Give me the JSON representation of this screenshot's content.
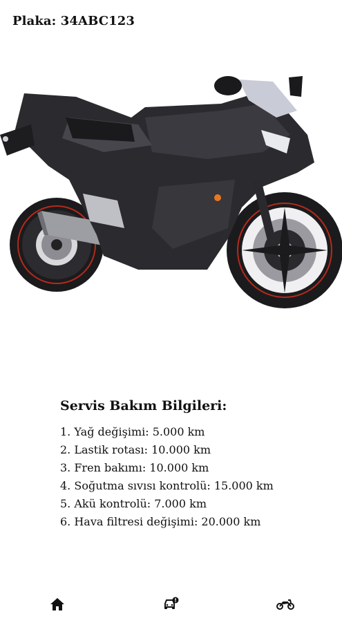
{
  "header": {
    "plate_text": "Plaka: 34ABC123"
  },
  "vehicle_image": {
    "subject": "motorcycle"
  },
  "service": {
    "title": "Servis Bakım Bilgileri:",
    "items": [
      "1. Yağ değişimi: 5.000 km",
      "2. Lastik rotası: 10.000 km",
      "3. Fren bakımı: 10.000 km",
      "4. Soğutma sıvısı kontrolü: 15.000 km",
      "5. Akü kontrolü: 7.000 km",
      "6. Hava filtresi değişimi: 20.000 km"
    ]
  },
  "bottom_nav": {
    "items": [
      {
        "icon": "home-icon"
      },
      {
        "icon": "car-service-icon"
      },
      {
        "icon": "motorcycle-icon"
      }
    ]
  },
  "colors": {
    "text": "#111111",
    "background": "#ffffff",
    "bike_body": "#2b2a2e",
    "bike_accent": "#c8321e",
    "brake_light": "#e87722"
  }
}
